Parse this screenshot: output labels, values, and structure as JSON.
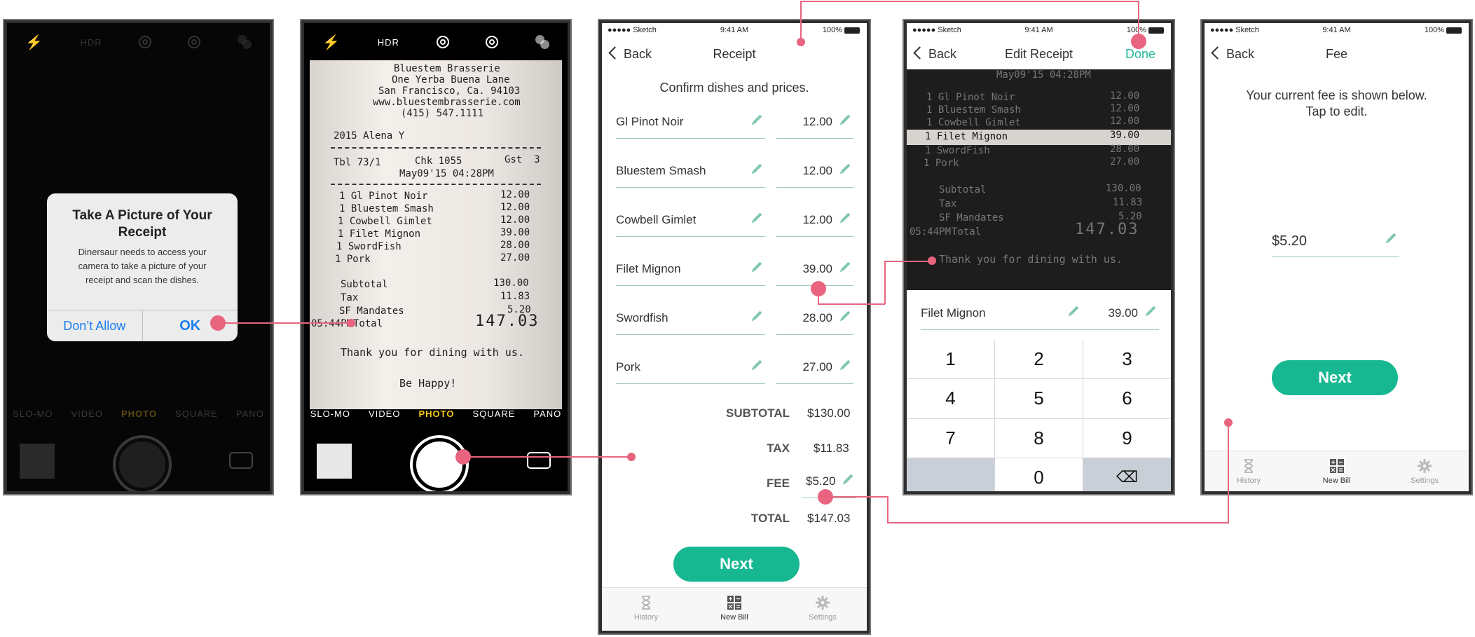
{
  "camera": {
    "hdr": "HDR",
    "modes": [
      "SLO-MO",
      "VIDEO",
      "PHOTO",
      "SQUARE",
      "PANO"
    ],
    "selected_mode": "PHOTO"
  },
  "alert": {
    "title": "Take A Picture of Your Receipt",
    "message": "Dinersaur needs to access your camera to take a picture of your receipt and scan the dishes.",
    "dont_allow": "Don’t Allow",
    "ok": "OK"
  },
  "receipt_photo": {
    "lines": [
      "Bluestem Brasserie",
      "One Yerba Buena Lane",
      "San Francisco, Ca. 94103",
      "www.bluestembrasserie.com",
      "(415) 547.1111"
    ],
    "server": "2015 Alena Y",
    "tbl": "Tbl 73/1",
    "chk": "Chk 1055",
    "gst": "Gst  3",
    "date": "May09'15 04:28PM",
    "items": [
      {
        "name": "1 Gl Pinot Noir",
        "price": "12.00"
      },
      {
        "name": "1 Bluestem Smash",
        "price": "12.00"
      },
      {
        "name": "1 Cowbell Gimlet",
        "price": "12.00"
      },
      {
        "name": "1 Filet Mignon",
        "price": "39.00"
      },
      {
        "name": "1 SwordFish",
        "price": "28.00"
      },
      {
        "name": "1 Pork",
        "price": "27.00"
      }
    ],
    "subtotal_label": "Subtotal",
    "subtotal": "130.00",
    "tax_label": "Tax",
    "tax": "11.83",
    "sf_label": "SF Mandates",
    "sf": "5.20",
    "time": "05:44PM",
    "total_label": "Total",
    "total": "147.03",
    "thanks": "Thank you for dining with us.",
    "happy": "Be Happy!"
  },
  "status": {
    "carrier": "●●●●● Sketch",
    "time": "9:41 AM",
    "battery": "100%"
  },
  "receipt_screen": {
    "back": "Back",
    "title": "Receipt",
    "subtitle": "Confirm dishes and prices.",
    "items": [
      {
        "name": "Gl Pinot Noir",
        "price": "12.00"
      },
      {
        "name": "Bluestem Smash",
        "price": "12.00"
      },
      {
        "name": "Cowbell Gimlet",
        "price": "12.00"
      },
      {
        "name": "Filet Mignon",
        "price": "39.00"
      },
      {
        "name": "Swordfish",
        "price": "28.00"
      },
      {
        "name": "Pork",
        "price": "27.00"
      }
    ],
    "subtotal_label": "SUBTOTAL",
    "subtotal": "$130.00",
    "tax_label": "TAX",
    "tax": "$11.83",
    "fee_label": "FEE",
    "fee": "$5.20",
    "total_label": "TOTAL",
    "total": "$147.03",
    "next": "Next"
  },
  "tabs": [
    {
      "label": "History",
      "icon": "hourglass-icon"
    },
    {
      "label": "New Bill",
      "icon": "calculator-icon"
    },
    {
      "label": "Settings",
      "icon": "gear-icon"
    }
  ],
  "edit_screen": {
    "back": "Back",
    "title": "Edit Receipt",
    "done": "Done",
    "item_name": "Filet Mignon",
    "item_price": "39.00",
    "keys": [
      "1",
      "2",
      "3",
      "4",
      "5",
      "6",
      "7",
      "8",
      "9",
      "",
      "0",
      "⌫"
    ]
  },
  "fee_screen": {
    "back": "Back",
    "title": "Fee",
    "line1": "Your current fee is shown below.",
    "line2": "Tap to edit.",
    "fee_value": "$5.20",
    "next": "Next"
  },
  "colors": {
    "accent": "#17b891",
    "connector": "#e8647f",
    "ios_blue": "#1a7ff0"
  }
}
